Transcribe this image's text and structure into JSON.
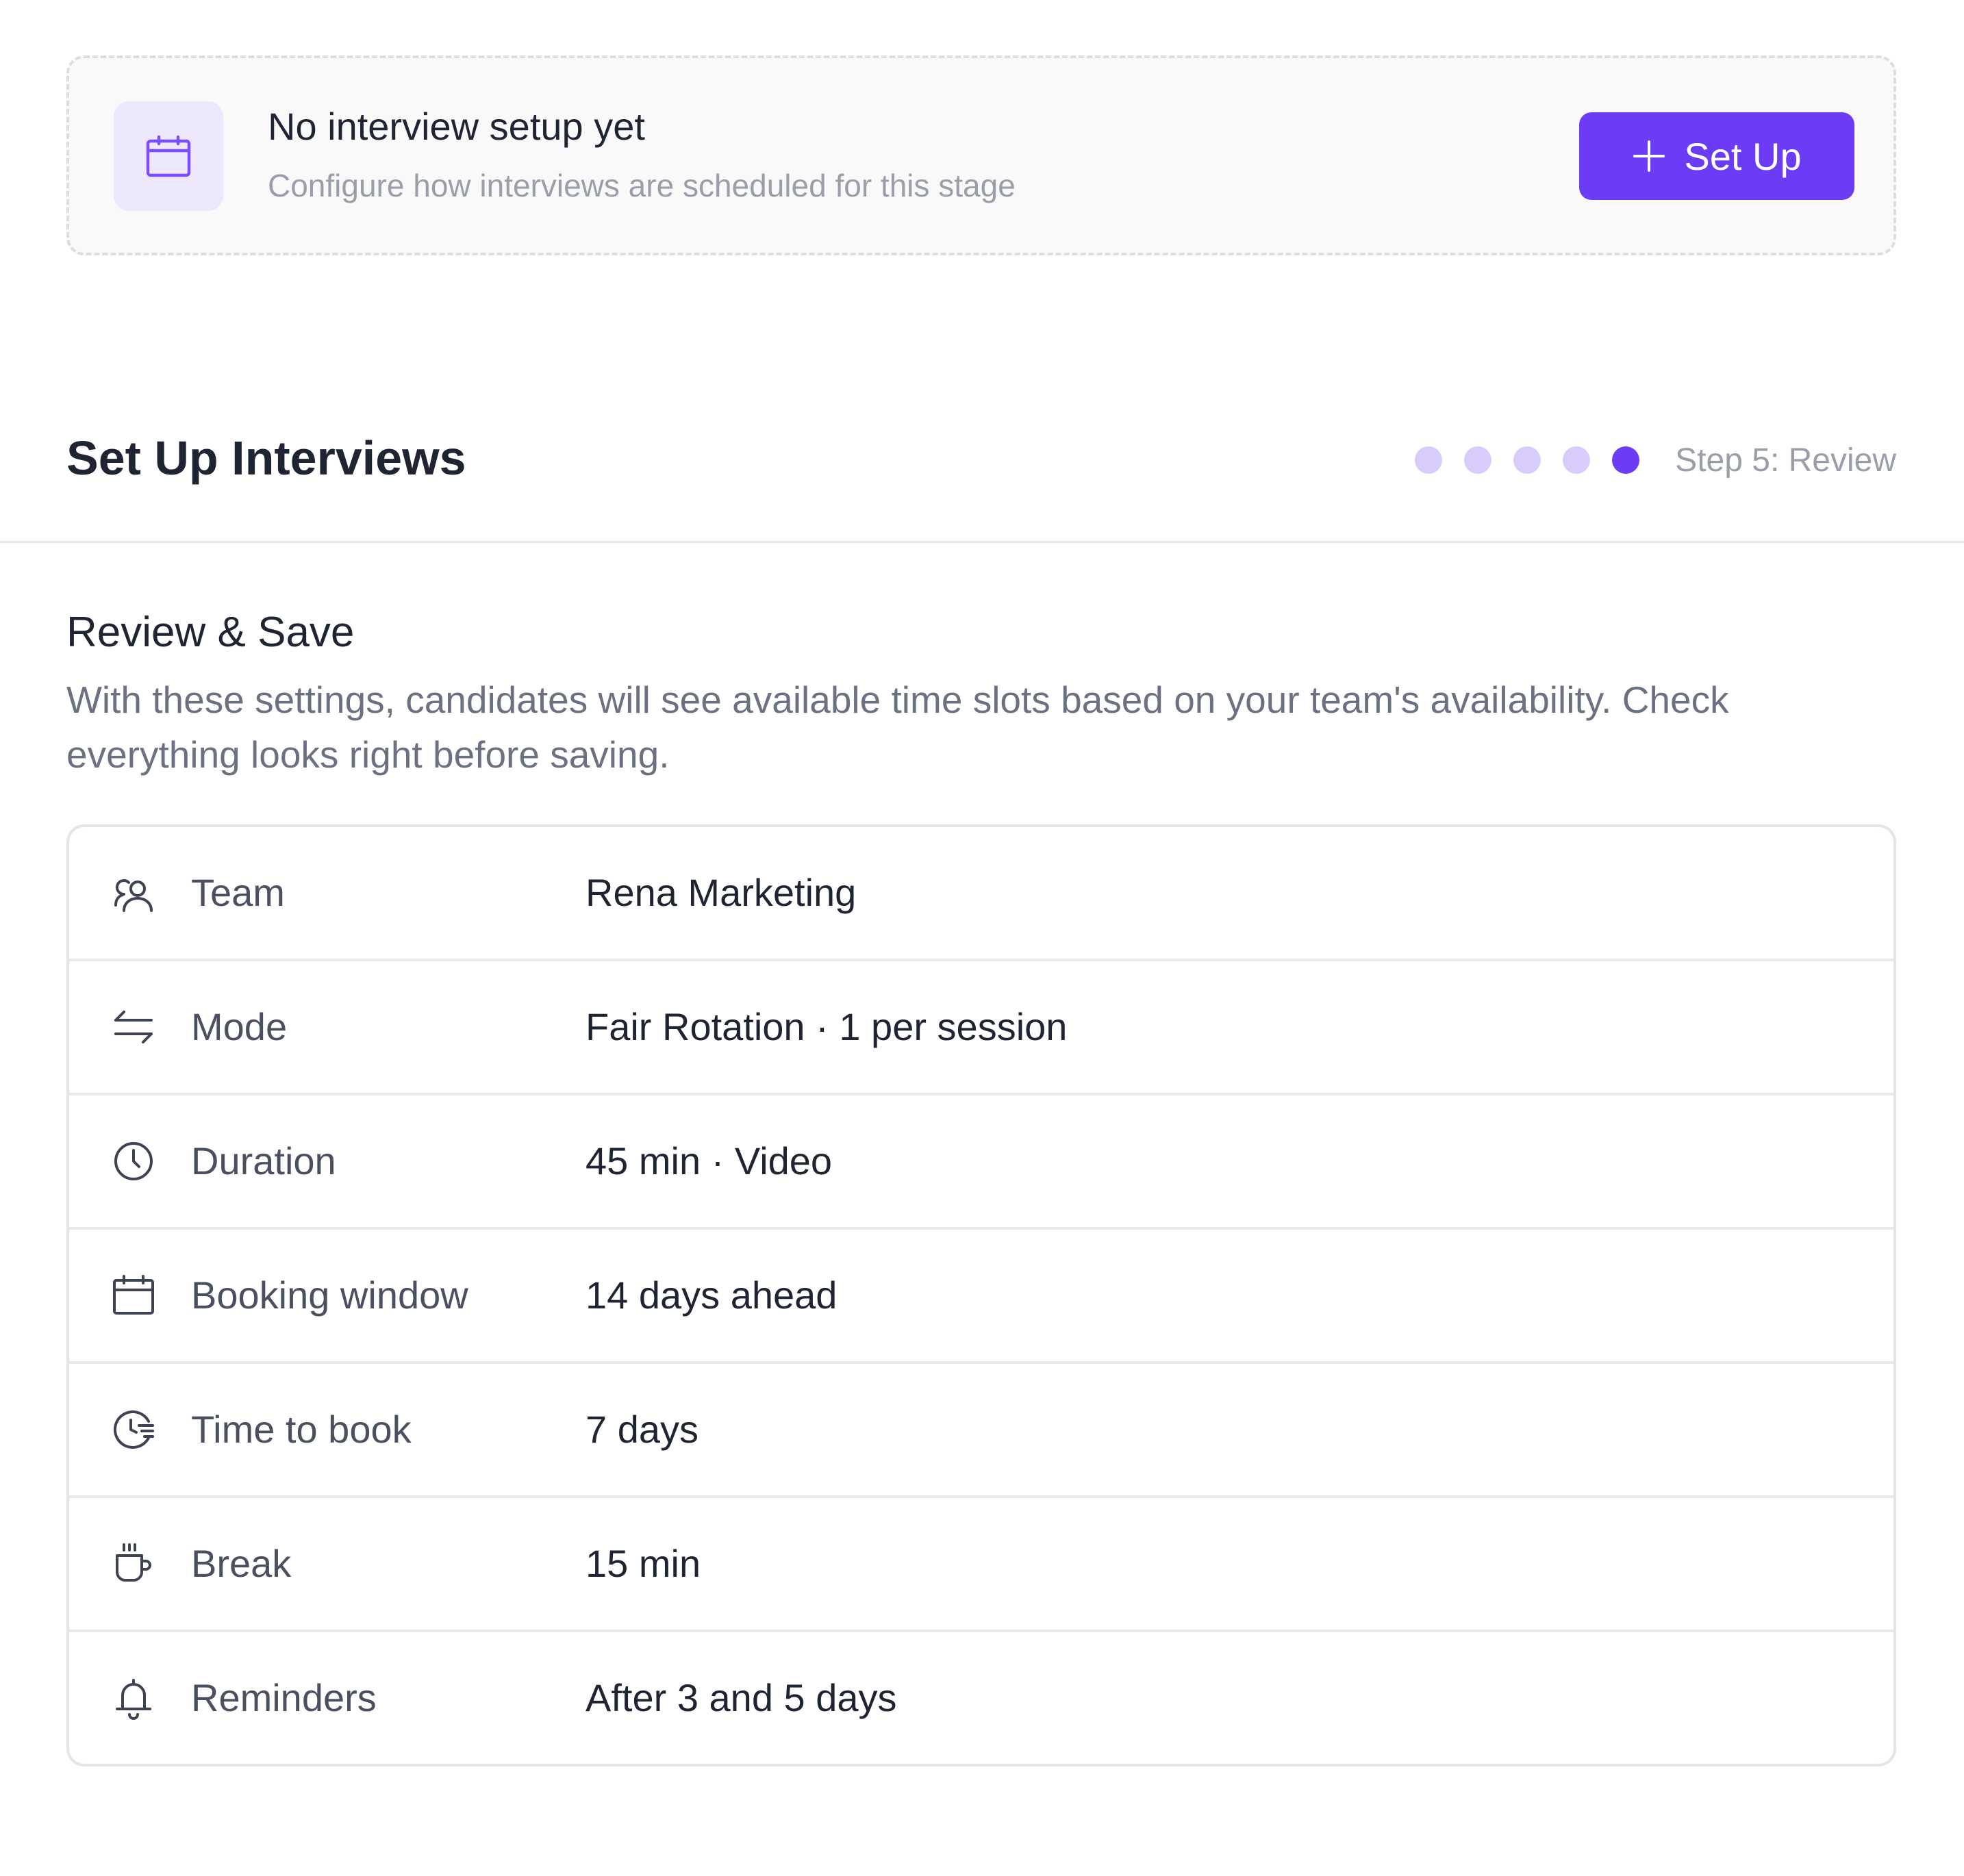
{
  "empty_state": {
    "icon": "calendar-icon",
    "title": "No interview setup yet",
    "subtitle": "Configure how interviews are scheduled for this stage",
    "button_label": "Set Up",
    "button_icon": "plus-icon"
  },
  "wizard": {
    "title": "Set Up Interviews",
    "total_steps": 5,
    "current_step": 5,
    "step_label": "Step 5: Review"
  },
  "review": {
    "title": "Review & Save",
    "description": "With these settings, candidates will see available time slots based on your team's availability. Check everything looks right before saving.",
    "rows": [
      {
        "icon": "users-icon",
        "label": "Team",
        "value": "Rena Marketing"
      },
      {
        "icon": "arrows-swap-icon",
        "label": "Mode",
        "value": "Fair Rotation · 1 per session"
      },
      {
        "icon": "clock-icon",
        "label": "Duration",
        "value": "45 min · Video"
      },
      {
        "icon": "calendar-icon",
        "label": "Booking window",
        "value": "14 days ahead"
      },
      {
        "icon": "clock-list-icon",
        "label": "Time to book",
        "value": "7 days"
      },
      {
        "icon": "coffee-cup-icon",
        "label": "Break",
        "value": "15 min"
      },
      {
        "icon": "bell-icon",
        "label": "Reminders",
        "value": "After 3 and 5 days"
      }
    ]
  },
  "colors": {
    "accent": "#6b3bf5",
    "accent_light": "#d7ccfb",
    "icon_bg": "#ede8fc",
    "text_primary": "#1f2433",
    "text_secondary": "#6b7180",
    "text_muted": "#9a9ea9"
  }
}
